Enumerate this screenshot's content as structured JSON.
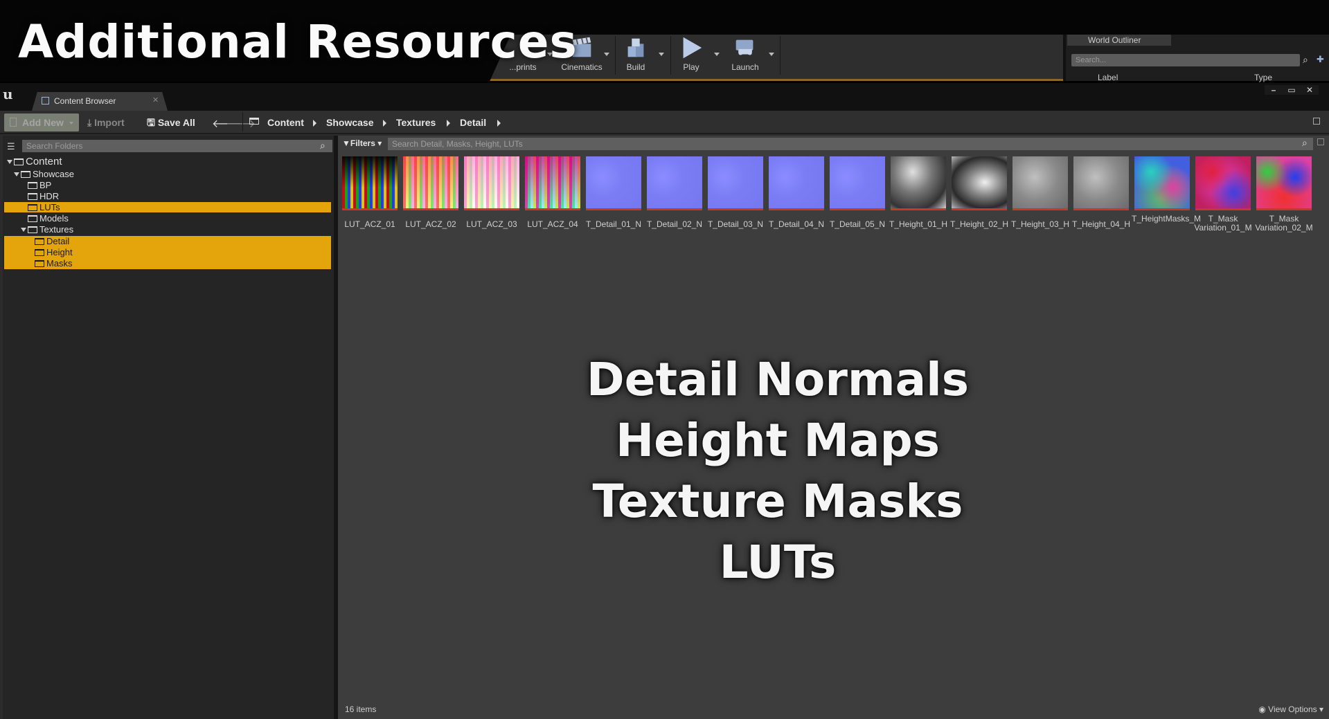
{
  "title": "Additional Resources",
  "toolbar": {
    "items": [
      {
        "label": "...prints"
      },
      {
        "label": "Cinematics"
      },
      {
        "label": "Build"
      },
      {
        "label": "Play"
      },
      {
        "label": "Launch"
      }
    ]
  },
  "world_outliner": {
    "tab": "World Outliner",
    "search_placeholder": "Search...",
    "col_label": "Label",
    "col_type": "Type"
  },
  "content_browser": {
    "tab": "Content Browser",
    "add_new": "Add New",
    "import": "Import",
    "save_all": "Save All",
    "breadcrumbs": [
      "Content",
      "Showcase",
      "Textures",
      "Detail"
    ],
    "folder_search_placeholder": "Search Folders",
    "asset_search_placeholder": "Search Detail, Masks, Height, LUTs",
    "filters": "Filters",
    "item_count": "16 items",
    "view_options": "View Options"
  },
  "folders": [
    {
      "label": "Content",
      "level": 0,
      "selected": false
    },
    {
      "label": "Showcase",
      "level": 1,
      "selected": false
    },
    {
      "label": "BP",
      "level": 2,
      "selected": false
    },
    {
      "label": "HDR",
      "level": 2,
      "selected": false
    },
    {
      "label": "LUTs",
      "level": 2,
      "selected": true
    },
    {
      "label": "Models",
      "level": 2,
      "selected": false
    },
    {
      "label": "Textures",
      "level": 2,
      "selected": false
    },
    {
      "label": "Detail",
      "level": 3,
      "selected": true
    },
    {
      "label": "Height",
      "level": 3,
      "selected": true
    },
    {
      "label": "Masks",
      "level": 3,
      "selected": true
    }
  ],
  "assets": [
    {
      "name": "LUT_ACZ_01",
      "kind": "lut1"
    },
    {
      "name": "LUT_ACZ_02",
      "kind": "lut2"
    },
    {
      "name": "LUT_ACZ_03",
      "kind": "lut3"
    },
    {
      "name": "LUT_ACZ_04",
      "kind": "lut4"
    },
    {
      "name": "T_Detail_01_N",
      "kind": "normal"
    },
    {
      "name": "T_Detail_02_N",
      "kind": "normal"
    },
    {
      "name": "T_Detail_03_N",
      "kind": "normal"
    },
    {
      "name": "T_Detail_04_N",
      "kind": "normal"
    },
    {
      "name": "T_Detail_05_N",
      "kind": "normal"
    },
    {
      "name": "T_Height_01_H",
      "kind": "height"
    },
    {
      "name": "T_Height_02_H",
      "kind": "height2"
    },
    {
      "name": "T_Height_03_H",
      "kind": "height3"
    },
    {
      "name": "T_Height_04_H",
      "kind": "height3"
    },
    {
      "name": "T_HeightMasks_M",
      "kind": "mask1"
    },
    {
      "name": "T_Mask Variation_01_M",
      "kind": "mask2"
    },
    {
      "name": "T_Mask Variation_02_M",
      "kind": "mask3"
    }
  ],
  "overlay_lines": [
    "Detail Normals",
    "Height Maps",
    "Texture Masks",
    "LUTs"
  ],
  "colors": {
    "selection": "#e3a50b",
    "accent_line": "#8a6a1e"
  }
}
